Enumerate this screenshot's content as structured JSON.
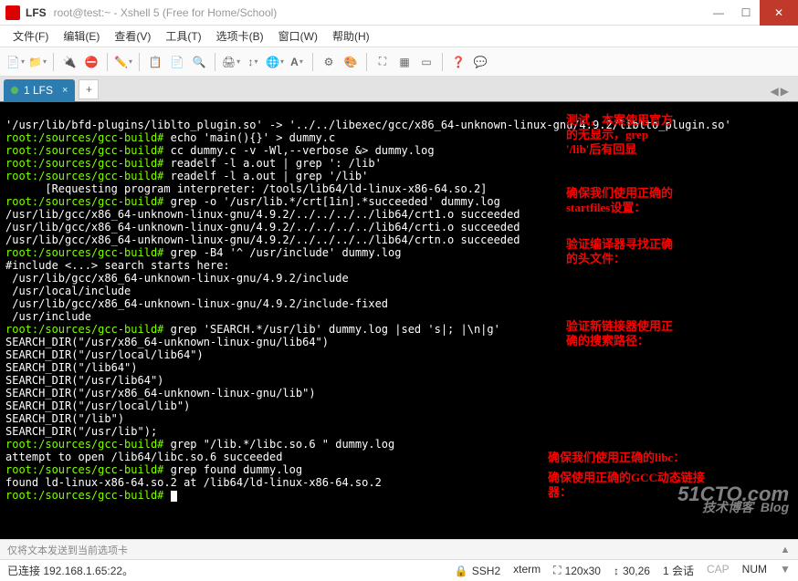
{
  "title": {
    "app": "LFS",
    "sub": "root@test:~ - Xshell 5 (Free for Home/School)"
  },
  "menu": {
    "file": "文件(F)",
    "edit": "编辑(E)",
    "view": "查看(V)",
    "tools": "工具(T)",
    "tabs": "选项卡(B)",
    "window": "窗口(W)",
    "help": "帮助(H)"
  },
  "tab": {
    "name": "1 LFS"
  },
  "terminal": {
    "l1": "'/usr/lib/bfd-plugins/liblto_plugin.so' -> '../../libexec/gcc/x86_64-unknown-linux-gnu/4.9.2/liblto_plugin.so'",
    "p1": "root:/sources/gcc-build#",
    "c1": " echo 'main(){}' > dummy.c",
    "p2": "root:/sources/gcc-build#",
    "c2": " cc dummy.c -v -Wl,--verbose &> dummy.log",
    "p3": "root:/sources/gcc-build#",
    "c3": " readelf -l a.out | grep ': /lib'",
    "p4": "root:/sources/gcc-build#",
    "c4": " readelf -l a.out | grep '/lib'",
    "o1": "      [Requesting program interpreter: /tools/lib64/ld-linux-x86-64.so.2]",
    "p5": "root:/sources/gcc-build#",
    "c5": " grep -o '/usr/lib.*/crt[1in].*succeeded' dummy.log",
    "o2": "/usr/lib/gcc/x86_64-unknown-linux-gnu/4.9.2/../../../../lib64/crt1.o succeeded",
    "o3": "/usr/lib/gcc/x86_64-unknown-linux-gnu/4.9.2/../../../../lib64/crti.o succeeded",
    "o4": "/usr/lib/gcc/x86_64-unknown-linux-gnu/4.9.2/../../../../lib64/crtn.o succeeded",
    "p6": "root:/sources/gcc-build#",
    "c6": " grep -B4 '^ /usr/include' dummy.log",
    "o5": "#include <...> search starts here:",
    "o6": " /usr/lib/gcc/x86_64-unknown-linux-gnu/4.9.2/include",
    "o7": " /usr/local/include",
    "o8": " /usr/lib/gcc/x86_64-unknown-linux-gnu/4.9.2/include-fixed",
    "o9": " /usr/include",
    "p7": "root:/sources/gcc-build#",
    "c7": " grep 'SEARCH.*/usr/lib' dummy.log |sed 's|; |\\n|g'",
    "o10": "SEARCH_DIR(\"/usr/x86_64-unknown-linux-gnu/lib64\")",
    "o11": "SEARCH_DIR(\"/usr/local/lib64\")",
    "o12": "SEARCH_DIR(\"/lib64\")",
    "o13": "SEARCH_DIR(\"/usr/lib64\")",
    "o14": "SEARCH_DIR(\"/usr/x86_64-unknown-linux-gnu/lib\")",
    "o15": "SEARCH_DIR(\"/usr/local/lib\")",
    "o16": "SEARCH_DIR(\"/lib\")",
    "o17": "SEARCH_DIR(\"/usr/lib\");",
    "p8": "root:/sources/gcc-build#",
    "c8": " grep \"/lib.*/libc.so.6 \" dummy.log",
    "o18": "attempt to open /lib64/libc.so.6 succeeded",
    "p9": "root:/sources/gcc-build#",
    "c9": " grep found dummy.log",
    "o19": "found ld-linux-x86-64.so.2 at /lib64/ld-linux-x86-64.so.2",
    "p10": "root:/sources/gcc-build#"
  },
  "ann": {
    "a1": "测试，本案使用官方\n的无显示，grep\n'/lib'后有回显",
    "a2": "确保我们使用正确的\nstartfiles设置：",
    "a3": "验证编译器寻找正确\n的头文件：",
    "a4": "验证新链接器使用正\n确的搜索路径：",
    "a5": "确保我们使用正确的libc：",
    "a6": "确保使用正确的GCC动态链接\n器："
  },
  "info": "仅将文本发送到当前选项卡",
  "status": {
    "conn": "已连接 192.168.1.65:22。",
    "ssh": "SSH2",
    "term": "xterm",
    "size": "120x30",
    "pos": "30,26",
    "sess": "1 会话",
    "cap": "CAP",
    "num": "NUM"
  },
  "wm": {
    "main": "51CTO.com",
    "sub": "技术博客  Blog"
  }
}
